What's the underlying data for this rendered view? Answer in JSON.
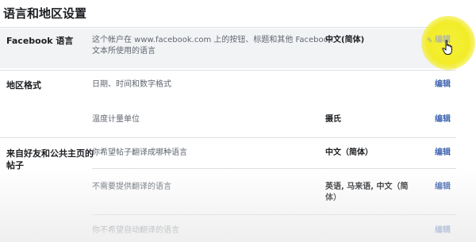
{
  "page_title": "语言和地区设置",
  "sections": {
    "facebook_language": {
      "label": "Facebook 语言",
      "description": [
        "这个帐户在 www.facebook.com 上的按钮、标题和其他 Facebook",
        "文本所使用的语言"
      ],
      "value": "中文(简体)",
      "edit": "编辑"
    },
    "region_format": {
      "label": "地区格式",
      "rows": [
        {
          "description": "日期、时间和数字格式",
          "value": "",
          "edit": "编辑"
        },
        {
          "description": "温度计量单位",
          "value": "摄氏",
          "edit": "编辑"
        }
      ]
    },
    "posts_from_friends": {
      "label": [
        "来自好友和公共主页的",
        "帖子"
      ],
      "rows": [
        {
          "description": "你希望帖子翻译成哪种语言",
          "value": "中文（简体）",
          "edit": "编辑"
        },
        {
          "description": "不需要提供翻译的语言",
          "value": [
            "英语, 马来语, 中文（简",
            "体）"
          ],
          "edit": "编辑"
        },
        {
          "description": "你不希望自动翻译的语言",
          "value": "",
          "edit": "编辑"
        }
      ]
    }
  },
  "colors": {
    "link": "#4267b2",
    "highlight": "#f2ec28",
    "row_highlight": "#f2f3f5"
  },
  "icons": {
    "pencil": "pencil-icon",
    "cursor": "hand-cursor-icon"
  }
}
